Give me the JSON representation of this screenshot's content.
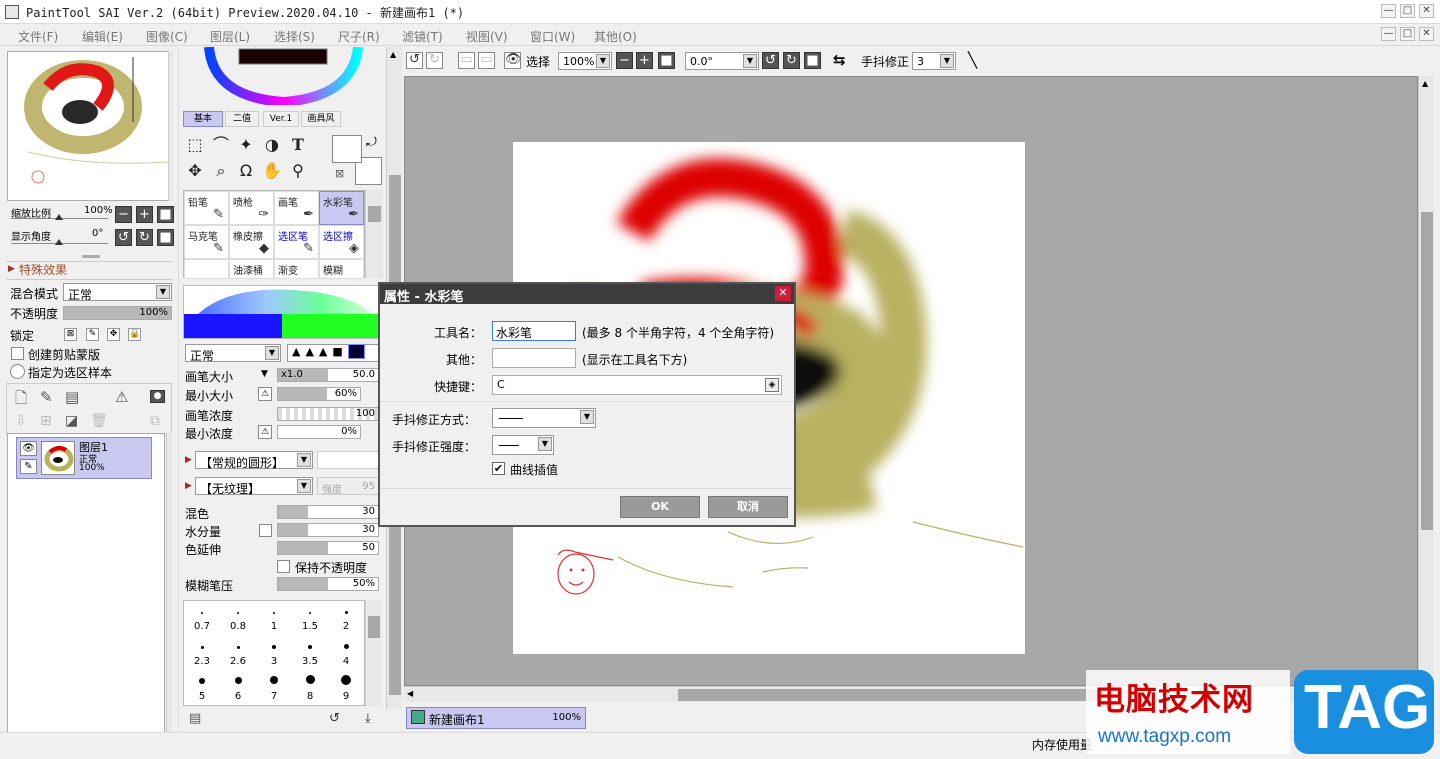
{
  "window": {
    "title": "PaintTool SAI Ver.2 (64bit) Preview.2020.04.10 - 新建画布1 (*)",
    "minimize": "—",
    "maximize": "□",
    "close": "✕"
  },
  "menu": [
    "文件(F)",
    "编辑(E)",
    "图像(C)",
    "图层(L)",
    "选择(S)",
    "尺子(R)",
    "滤镜(T)",
    "视图(V)",
    "窗口(W)",
    "其他(O)"
  ],
  "navigator": {
    "zoom_label": "缩放比例",
    "zoom_value": "100%",
    "angle_label": "显示角度",
    "angle_value": "0°"
  },
  "effects_header": "特殊效果",
  "layer_props": {
    "blend_label": "混合模式",
    "blend_value": "正常",
    "opacity_label": "不透明度",
    "opacity_value": "100%",
    "opacity_fraction": 1.0,
    "lock_label": "锁定",
    "clip_label": "创建剪贴蒙版",
    "sel_source_label": "指定为选区样本"
  },
  "layer": {
    "name": "图层1",
    "mode": "正常",
    "opacity": "100%"
  },
  "tool_tabs": [
    "基本",
    "二值",
    "Ver.1",
    "画具风"
  ],
  "brushes": [
    {
      "name": "铅笔",
      "icon": "pencil-icon"
    },
    {
      "name": "喷枪",
      "icon": "airbrush-icon"
    },
    {
      "name": "画笔",
      "icon": "brush-icon"
    },
    {
      "name": "水彩笔",
      "icon": "watercolor-icon"
    },
    {
      "name": "马克笔",
      "icon": "marker-icon"
    },
    {
      "name": "橡皮擦",
      "icon": "eraser-icon"
    },
    {
      "name": "选区笔",
      "icon": "select-pen-icon"
    },
    {
      "name": "选区擦",
      "icon": "select-eraser-icon"
    },
    {
      "name": "",
      "icon": ""
    },
    {
      "name": "油漆桶",
      "icon": "bucket-icon"
    },
    {
      "name": "渐变",
      "icon": "gradient-icon"
    },
    {
      "name": "模糊",
      "icon": "blur-icon"
    }
  ],
  "brush_settings": {
    "mode": "正常",
    "size_label": "画笔大小",
    "size_mult": "x1.0",
    "size_value": "50.0",
    "min_size_label": "最小大小",
    "min_size_value": "60%",
    "min_size_fraction": 0.6,
    "density_label": "画笔浓度",
    "density_value": "100",
    "min_density_label": "最小浓度",
    "min_density_value": "0%",
    "shape": "【常规的圆形】",
    "texture": "【无纹理】",
    "texture_strength": "强度",
    "texture_strength_value": "95",
    "blend_label": "混色",
    "blend_value": "30",
    "blend_fraction": 0.3,
    "water_label": "水分量",
    "water_value": "30",
    "water_fraction": 0.3,
    "persist_label": "色延伸",
    "persist_value": "50",
    "persist_fraction": 0.5,
    "keep_opacity_label": "保持不透明度",
    "blur_label": "模糊笔压",
    "blur_value": "50%",
    "blur_fraction": 0.5
  },
  "brush_sizes": [
    "0.7",
    "0.8",
    "1",
    "1.5",
    "2",
    "2.3",
    "2.6",
    "3",
    "3.5",
    "4",
    "5",
    "6",
    "7",
    "8",
    "9"
  ],
  "canvas_toolbar": {
    "select_label": "选择",
    "zoom": "100%",
    "angle": "0.0°",
    "stabilizer_label": "手抖修正",
    "stabilizer_value": "3"
  },
  "canvas_tab": {
    "name": "新建画布1",
    "zoom": "100%"
  },
  "status": {
    "memory": "内存使用量"
  },
  "watermark": {
    "text_cn": "电脑技术网",
    "url": "www.tagxp.com",
    "tag": "TAG"
  },
  "dialog": {
    "title": "属性 - 水彩笔",
    "name_label": "工具名：",
    "name_value": "水彩笔",
    "name_hint": "(最多 8 个半角字符，4 个全角字符)",
    "other_label": "其他：",
    "other_value": "",
    "other_hint": "(显示在工具名下方)",
    "shortcut_label": "快捷键：",
    "shortcut_value": "C",
    "stab_mode_label": "手抖修正方式：",
    "stab_strength_label": "手抖修正强度：",
    "curve_label": "曲线插值",
    "ok": "OK",
    "cancel": "取消"
  },
  "colors": {
    "accent": "#c8c8f0",
    "dialog_title": "#3c3c3c",
    "brush_red": "#dd0000",
    "brush_khaki": "#b9b061"
  }
}
